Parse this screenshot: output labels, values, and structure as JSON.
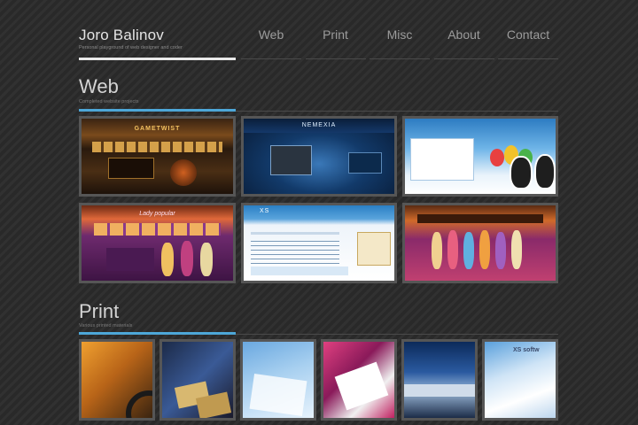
{
  "header": {
    "name": "Joro Balinov",
    "tagline": "Personal playground of web designer and coder"
  },
  "nav": {
    "items": [
      {
        "label": "Web"
      },
      {
        "label": "Print"
      },
      {
        "label": "Misc"
      },
      {
        "label": "About"
      },
      {
        "label": "Contact"
      }
    ]
  },
  "sections": {
    "web": {
      "title": "Web",
      "subtitle": "Completed website projects",
      "thumbs": [
        {
          "label": "GAMETWIST",
          "kind": "casino"
        },
        {
          "label": "NEMEXIA",
          "kind": "space"
        },
        {
          "label": "",
          "kind": "penguins"
        },
        {
          "label": "Lady popular",
          "kind": "lady"
        },
        {
          "label": "XS",
          "kind": "xs"
        },
        {
          "label": "",
          "kind": "dolls"
        }
      ]
    },
    "print": {
      "title": "Print",
      "subtitle": "Various printed materials",
      "thumbs": [
        {
          "kind": "orange"
        },
        {
          "kind": "cards"
        },
        {
          "kind": "lightblue"
        },
        {
          "kind": "magenta"
        },
        {
          "kind": "bluephoto"
        },
        {
          "kind": "xsprint",
          "label": "XS softw"
        }
      ]
    }
  },
  "colors": {
    "accent": "#4da7d8",
    "background": "#2b2b2b",
    "thumb_border": "#565656"
  }
}
